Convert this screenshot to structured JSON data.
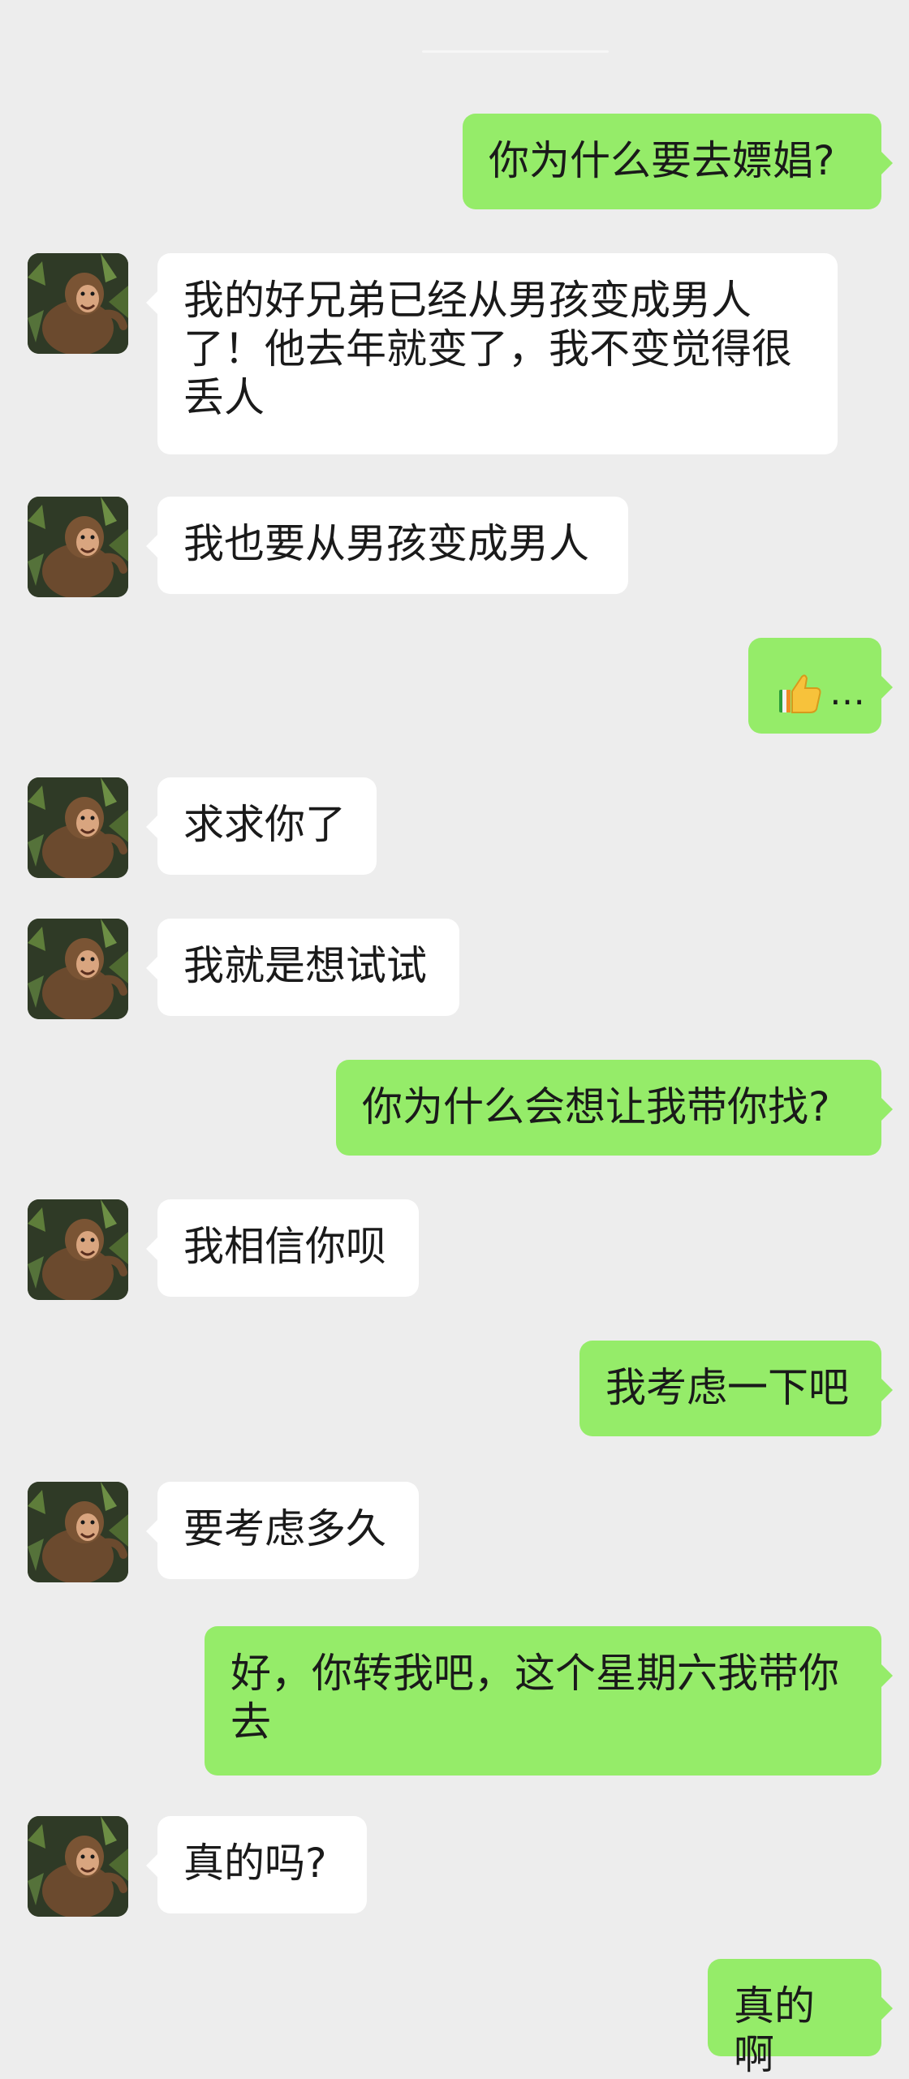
{
  "chat": {
    "messages": [
      {
        "sender": "me",
        "text": "你为什么要去嫖娼?"
      },
      {
        "sender": "friend",
        "text": "我的好兄弟已经从男孩变成男人了！他去年就变了，我不变觉得很丢人"
      },
      {
        "sender": "friend",
        "text": "我也要从男孩变成男人"
      },
      {
        "sender": "me",
        "icon": "thumbs-up-emoji",
        "text": "…"
      },
      {
        "sender": "friend",
        "text": "求求你了"
      },
      {
        "sender": "friend",
        "text": "我就是想试试"
      },
      {
        "sender": "me",
        "text": "你为什么会想让我带你找?"
      },
      {
        "sender": "friend",
        "text": "我相信你呗"
      },
      {
        "sender": "me",
        "text": "我考虑一下吧"
      },
      {
        "sender": "friend",
        "text": "要考虑多久"
      },
      {
        "sender": "me",
        "text": "好，你转我吧，这个星期六我带你去"
      },
      {
        "sender": "friend",
        "text": "真的吗?"
      },
      {
        "sender": "me",
        "text": "真的啊"
      }
    ]
  },
  "colors": {
    "background": "#ededed",
    "outgoing_bubble": "#95ec69",
    "incoming_bubble": "#ffffff",
    "text": "#1a1a1a"
  }
}
